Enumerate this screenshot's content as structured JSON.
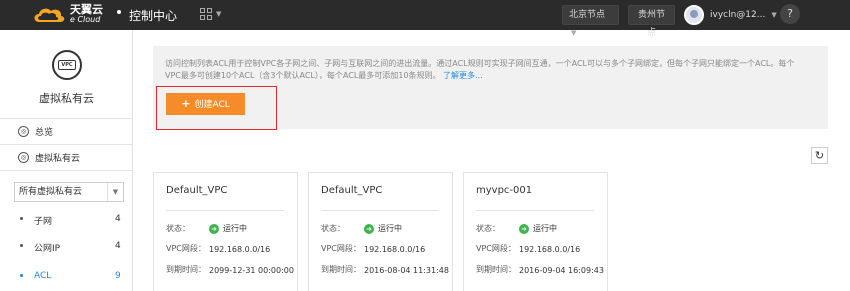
{
  "header": {
    "logo_cn": "天翼云",
    "logo_en": "e Cloud",
    "title": "控制中心",
    "region_current": "北京节点",
    "region_other": "贵州节点",
    "username": "ivycln@12..."
  },
  "sidebar": {
    "title": "虚拟私有云",
    "badge": "VPC",
    "nav": [
      {
        "label": "总览"
      },
      {
        "label": "虚拟私有云"
      }
    ],
    "select_value": "所有虚拟私有云",
    "sub_items": [
      {
        "label": "子网",
        "count": "4"
      },
      {
        "label": "公网IP",
        "count": "4"
      },
      {
        "label": "ACL",
        "count": "9"
      }
    ]
  },
  "main": {
    "info_text": "访问控制列表ACL用于控制VPC各子网之间、子网与互联网之间的进出流量。通过ACL规则可实现子网间互通，一个ACL可以与多个子网绑定，但每个子网只能绑定一个ACL。每个VPC最多可创建10个ACL（含3个默认ACL），每个ACL最多可添加10条规则。",
    "info_more": "了解更多...",
    "create_button": "创建ACL",
    "labels": {
      "status": "状态：",
      "vpc_segment": "VPC网段：",
      "expire": "到期时间："
    },
    "cards": [
      {
        "name": "Default_VPC",
        "status": "运行中",
        "segment": "192.168.0.0/16",
        "expire": "2099-12-31 00:00:00"
      },
      {
        "name": "Default_VPC",
        "status": "运行中",
        "segment": "192.168.0.0/16",
        "expire": "2016-08-04 11:31:48"
      },
      {
        "name": "myvpc-001",
        "status": "运行中",
        "segment": "192.168.0.0/16",
        "expire": "2016-09-04 16:09:43"
      }
    ]
  }
}
